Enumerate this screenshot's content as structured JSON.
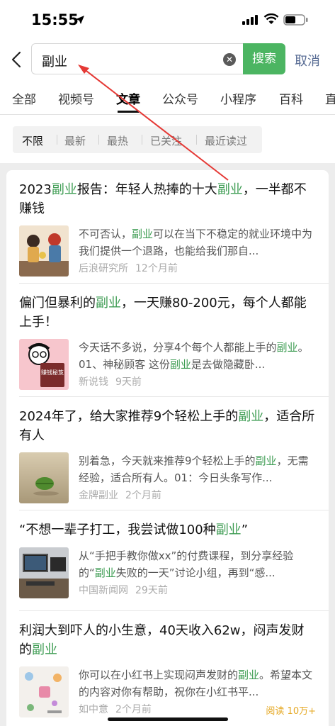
{
  "status_bar": {
    "time": "15:55"
  },
  "search": {
    "query": "副业",
    "button_label": "搜索",
    "cancel_label": "取消"
  },
  "tabs": [
    "全部",
    "视频号",
    "文章",
    "公众号",
    "小程序",
    "百科",
    "直"
  ],
  "active_tab": "文章",
  "filters": [
    "不限",
    "最新",
    "最热",
    "已关注",
    "最近读过"
  ],
  "active_filter": "不限",
  "results": [
    {
      "title_parts": [
        [
          "2023",
          false
        ],
        [
          "副业",
          true
        ],
        [
          "报告：年轻人热捧的十大",
          false
        ],
        [
          "副业",
          true
        ],
        [
          "，一半都不赚钱",
          false
        ]
      ],
      "snippet_parts": [
        [
          "不可否认，",
          false
        ],
        [
          "副业",
          true
        ],
        [
          "可以在当下不稳定的就业环境中为我们提供一个退路，也能给我们那自...",
          false
        ]
      ],
      "source": "后浪研究所",
      "time": "12个月前"
    },
    {
      "title_parts": [
        [
          "偏门但暴利的",
          false
        ],
        [
          "副业",
          true
        ],
        [
          "，一天赚80-200元，每个人都能上手！",
          false
        ]
      ],
      "snippet_parts": [
        [
          "今天话不多说，分享4个每个人都能上手的",
          false
        ],
        [
          "副业",
          true
        ],
        [
          "。01、神秘顾客 这份",
          false
        ],
        [
          "副业",
          true
        ],
        [
          "是去做隐藏卧...",
          false
        ]
      ],
      "source": "新说钱",
      "time": "9天前",
      "thumb_text": "赚钱秘笈"
    },
    {
      "title_parts": [
        [
          "2024年了，给大家推荐9个轻松上手的",
          false
        ],
        [
          "副业",
          true
        ],
        [
          "，适合所有人",
          false
        ]
      ],
      "snippet_parts": [
        [
          "别着急，今天就来推荐9个轻松上手的",
          false
        ],
        [
          "副业",
          true
        ],
        [
          "，无需经验，适合所有人。01：今日头条写作...",
          false
        ]
      ],
      "source": "金牌副业",
      "time": "2个月前"
    },
    {
      "title_parts": [
        [
          "“不想一辈子打工，我尝试做100种",
          false
        ],
        [
          "副业",
          true
        ],
        [
          "”",
          false
        ]
      ],
      "snippet_parts": [
        [
          "从“手把手教你做xx”的付费课程，到分享经验的“",
          false
        ],
        [
          "副业",
          true
        ],
        [
          "失败的一天”讨论小组，再到“感...",
          false
        ]
      ],
      "source": "中国新闻网",
      "time": "29天前"
    },
    {
      "title_parts": [
        [
          "利润大到吓人的小生意，40天收入62w，闷声发财的",
          false
        ],
        [
          "副业",
          true
        ]
      ],
      "snippet_parts": [
        [
          "你可以在小红书上实现闷声发财的",
          false
        ],
        [
          "副业",
          true
        ],
        [
          "。希望本文的内容对你有帮助，祝你在小红书平...",
          false
        ]
      ],
      "source": "如中意",
      "time": "2个月前",
      "read_count": "阅读 10万+"
    }
  ],
  "colors": {
    "accent_green": "#4cb562",
    "highlight_green": "#3f9d54",
    "cancel_blue": "#586c94",
    "annotation_red": "#e53935"
  }
}
